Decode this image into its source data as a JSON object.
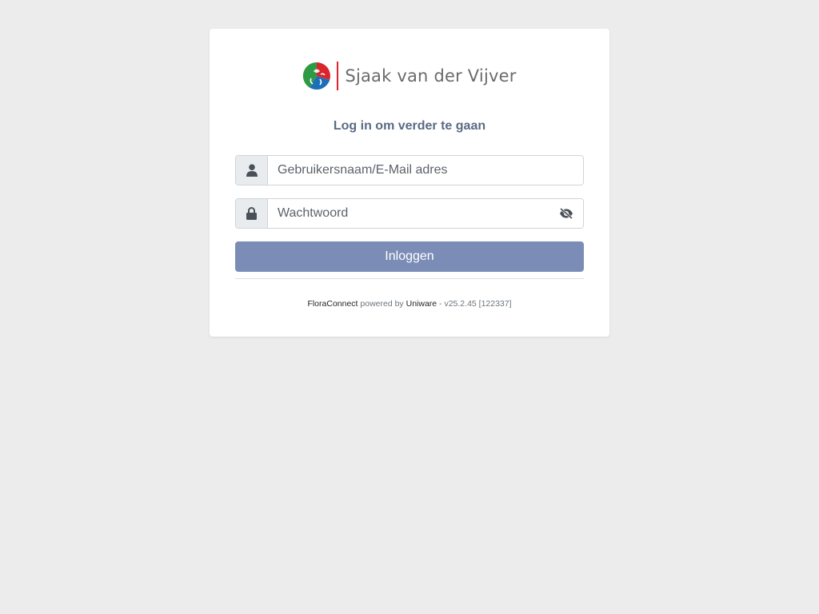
{
  "brand": {
    "name": "Sjaak van der Vijver",
    "accent_color": "#d9252c"
  },
  "login": {
    "heading": "Log in om verder te gaan",
    "username_placeholder": "Gebruikersnaam/E-Mail adres",
    "username_value": "",
    "password_placeholder": "Wachtwoord",
    "password_value": "",
    "submit_label": "Inloggen",
    "button_color": "#7b8db7"
  },
  "icons": {
    "username": "user-icon",
    "password": "lock-icon",
    "toggle_visibility": "eye-slash-icon"
  },
  "footer": {
    "product": "FloraConnect",
    "powered_by": "powered by",
    "vendor": "Uniware",
    "version": "- v25.2.45 [122337]"
  }
}
